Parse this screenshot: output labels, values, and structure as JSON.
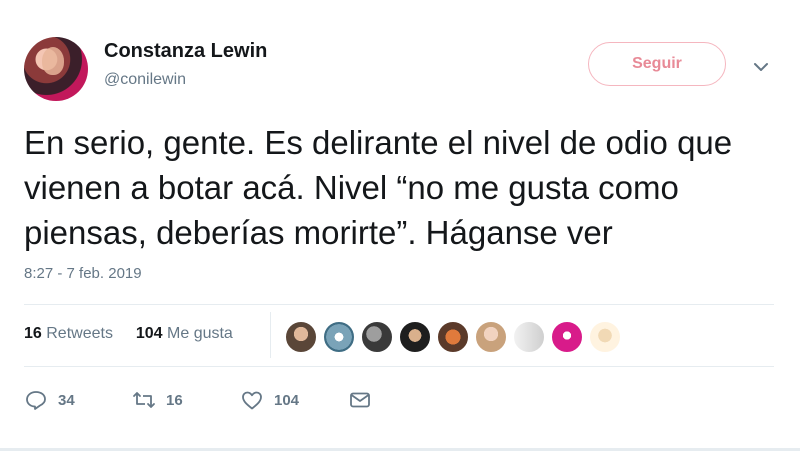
{
  "user": {
    "name": "Constanza Lewin",
    "handle": "@conilewin"
  },
  "follow_label": "Seguir",
  "tweet": {
    "text": "En serio, gente. Es delirante el nivel de odio que vienen a botar acá. Nivel “no me gusta como piensas, deberías morirte”. Háganse ver",
    "timestamp": "8:27 - 7 feb. 2019"
  },
  "stats": {
    "retweets_count": "16",
    "retweets_label": "Retweets",
    "likes_count": "104",
    "likes_label": "Me gusta"
  },
  "actions": {
    "replies": "34",
    "retweets": "16",
    "likes": "104"
  },
  "colors": {
    "follow_border": "#f5b6bf",
    "follow_text": "#e88a97",
    "muted_text": "#657786",
    "divider": "#e6ecf0"
  },
  "icons": {
    "caret": "chevron-down-icon",
    "reply": "reply-icon",
    "retweet": "retweet-icon",
    "like": "heart-icon",
    "message": "envelope-icon"
  }
}
